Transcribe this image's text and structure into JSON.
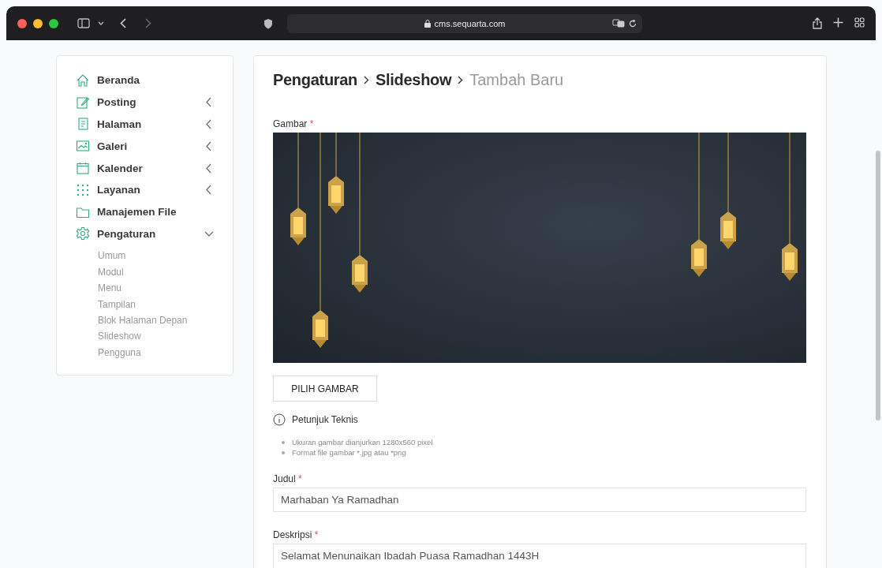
{
  "browser": {
    "url": "cms.sequarta.com"
  },
  "sidebar": {
    "items": [
      {
        "label": "Beranda",
        "kind": "link"
      },
      {
        "label": "Posting",
        "kind": "menu",
        "expanded": false
      },
      {
        "label": "Halaman",
        "kind": "menu",
        "expanded": false
      },
      {
        "label": "Galeri",
        "kind": "menu",
        "expanded": false
      },
      {
        "label": "Kalender",
        "kind": "menu",
        "expanded": false
      },
      {
        "label": "Layanan",
        "kind": "menu",
        "expanded": false
      },
      {
        "label": "Manajemen File",
        "kind": "link"
      },
      {
        "label": "Pengaturan",
        "kind": "menu",
        "expanded": true,
        "children": [
          {
            "label": "Umum"
          },
          {
            "label": "Modul"
          },
          {
            "label": "Menu"
          },
          {
            "label": "Tampilan"
          },
          {
            "label": "Blok Halaman Depan"
          },
          {
            "label": "Slideshow"
          },
          {
            "label": "Pengguna"
          }
        ]
      }
    ]
  },
  "breadcrumb": [
    {
      "label": "Pengaturan",
      "current": false
    },
    {
      "label": "Slideshow",
      "current": false
    },
    {
      "label": "Tambah Baru",
      "current": true
    }
  ],
  "image_field": {
    "label": "Gambar",
    "required_mark": "*",
    "button": "PILIH GAMBAR"
  },
  "hint": {
    "title": "Petunjuk Teknis",
    "items": [
      "Ukuran gambar dianjurkan 1280x560 pixel",
      "Format file gambar *.jpg atau *png"
    ]
  },
  "fields": [
    {
      "label": "Judul",
      "required_mark": "*",
      "value": "Marhaban Ya Ramadhan",
      "kind": "input"
    },
    {
      "label": "Deskripsi",
      "required_mark": "*",
      "value": "Selamat Menunaikan Ibadah Puasa Ramadhan 1443H",
      "kind": "textarea"
    }
  ]
}
